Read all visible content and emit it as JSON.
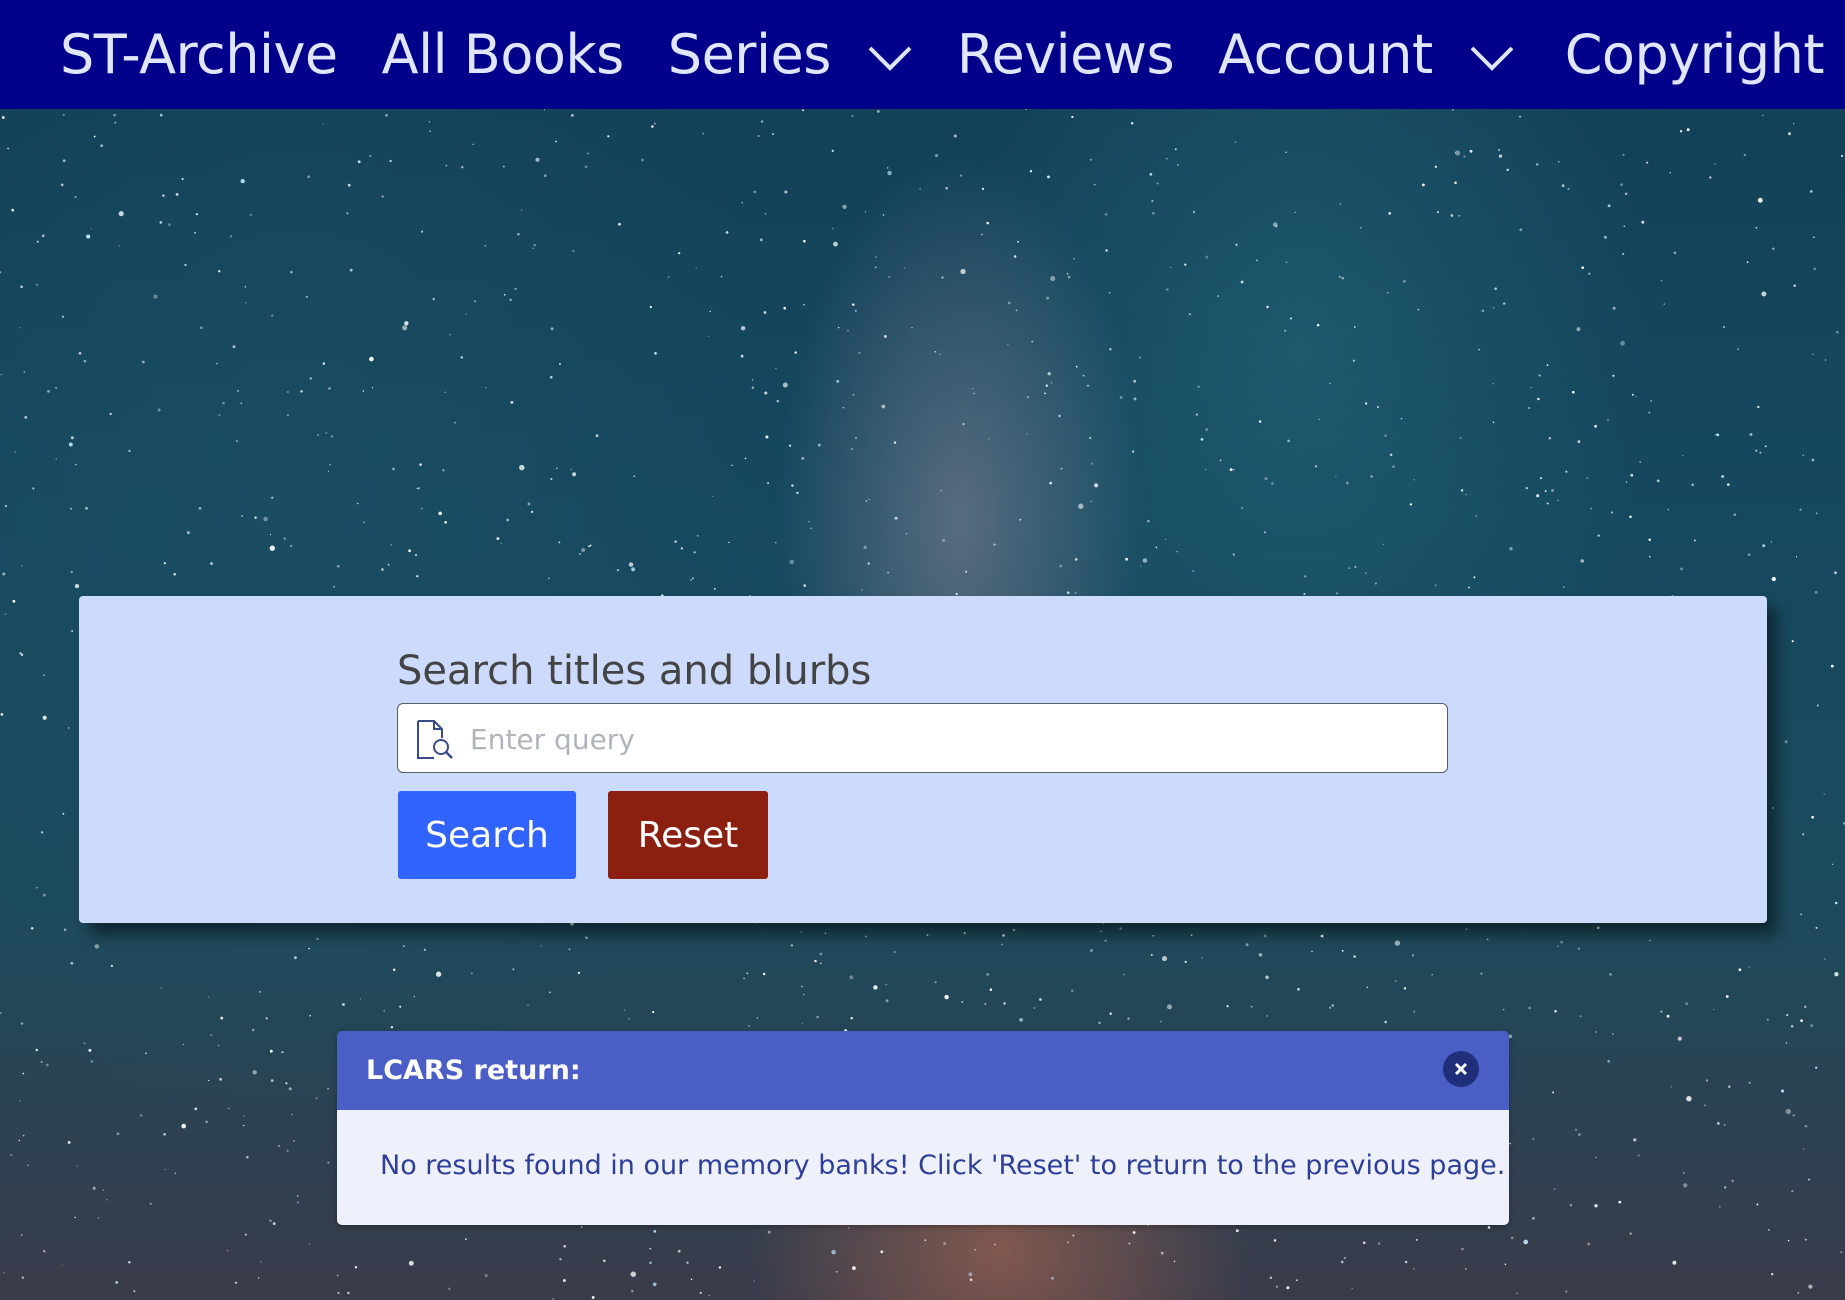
{
  "nav": {
    "brand": "ST-Archive",
    "all_books": "All Books",
    "series": "Series",
    "reviews": "Reviews",
    "account": "Account",
    "copyright": "Copyright",
    "background_color": "#00008b",
    "text_color": "#e0e6ff"
  },
  "search": {
    "label": "Search titles and blurbs",
    "placeholder": "Enter query",
    "value": "",
    "search_button": "Search",
    "reset_button": "Reset",
    "search_button_color": "#3063ff",
    "reset_button_color": "#8b2010",
    "card_color": "#ccdafc",
    "icon": "document-search-icon"
  },
  "toast": {
    "title": "LCARS return:",
    "message": "No results found in our memory banks! Click 'Reset' to return to the previous page.",
    "header_color": "#4a5ec6",
    "close_icon": "close-icon"
  },
  "background": {
    "description_icon": "starry-sky"
  }
}
